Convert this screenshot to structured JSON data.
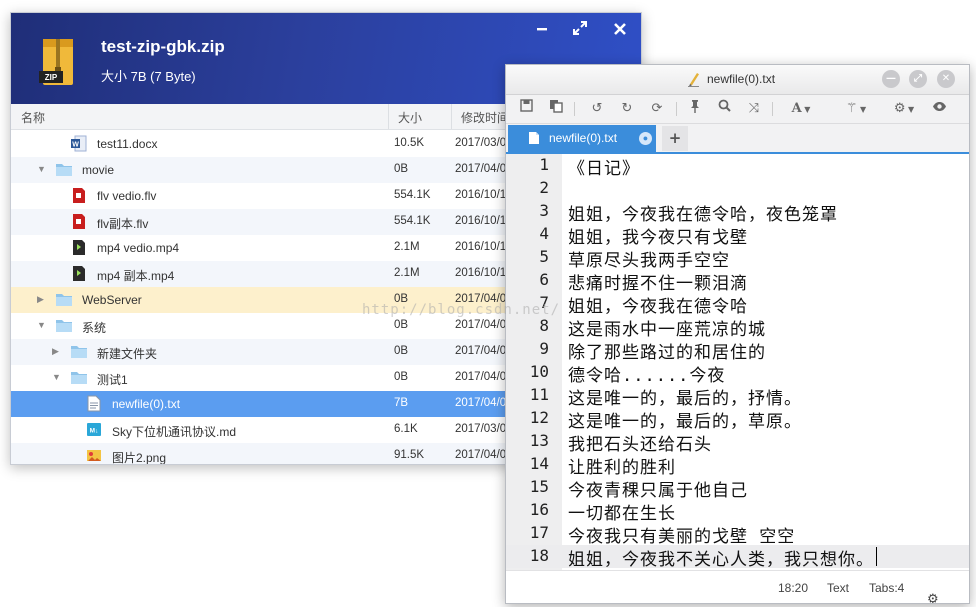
{
  "zip": {
    "title": "test-zip-gbk.zip",
    "subtitle": "大小 7B (7 Byte)",
    "icon_label": "ZIP",
    "columns": {
      "name": "名称",
      "size": "大小",
      "date": "修改时间"
    },
    "rows": [
      {
        "name": "test11.docx",
        "size": "10.5K",
        "date": "2017/03/0",
        "icon": "word-doc-icon",
        "indent": 1,
        "expander": "none",
        "style": "plain"
      },
      {
        "name": "movie",
        "size": "0B",
        "date": "2017/04/0",
        "icon": "folder-icon",
        "indent": 0,
        "expander": "open",
        "style": "alt"
      },
      {
        "name": "flv vedio.flv",
        "size": "554.1K",
        "date": "2016/10/1",
        "icon": "flv-file-icon",
        "indent": 1,
        "expander": "none",
        "style": "plain"
      },
      {
        "name": "flv副本.flv",
        "size": "554.1K",
        "date": "2016/10/1",
        "icon": "flv-file-icon",
        "indent": 1,
        "expander": "none",
        "style": "alt"
      },
      {
        "name": "mp4 vedio.mp4",
        "size": "2.1M",
        "date": "2016/10/1",
        "icon": "mp4-file-icon",
        "indent": 1,
        "expander": "none",
        "style": "plain"
      },
      {
        "name": "mp4 副本.mp4",
        "size": "2.1M",
        "date": "2016/10/1",
        "icon": "mp4-file-icon",
        "indent": 1,
        "expander": "none",
        "style": "alt"
      },
      {
        "name": "WebServer",
        "size": "0B",
        "date": "2017/04/0",
        "icon": "folder-icon",
        "indent": 0,
        "expander": "closed",
        "style": "hl"
      },
      {
        "name": "系统",
        "size": "0B",
        "date": "2017/04/0",
        "icon": "folder-icon",
        "indent": 0,
        "expander": "open",
        "style": "plain"
      },
      {
        "name": "新建文件夹",
        "size": "0B",
        "date": "2017/04/0",
        "icon": "folder-icon",
        "indent": 1,
        "expander": "closed",
        "style": "alt"
      },
      {
        "name": "测试1",
        "size": "0B",
        "date": "2017/04/0",
        "icon": "folder-icon",
        "indent": 1,
        "expander": "open",
        "style": "plain"
      },
      {
        "name": "newfile(0).txt",
        "size": "7B",
        "date": "2017/04/0",
        "icon": "text-file-icon",
        "indent": 2,
        "expander": "none",
        "style": "sel"
      },
      {
        "name": "Sky下位机通讯协议.md",
        "size": "6.1K",
        "date": "2017/03/0",
        "icon": "markdown-file-icon",
        "indent": 2,
        "expander": "none",
        "style": "plain"
      },
      {
        "name": "图片2.png",
        "size": "91.5K",
        "date": "2017/04/0",
        "icon": "image-file-icon",
        "indent": 2,
        "expander": "none",
        "style": "alt"
      }
    ]
  },
  "editor": {
    "window_title": "newfile(0).txt",
    "tab_label": "newfile(0).txt",
    "tab_add": "+",
    "lines": [
      "《日记》",
      "",
      "姐姐，今夜我在德令哈，夜色笼罩",
      "姐姐，我今夜只有戈壁",
      "草原尽头我两手空空",
      "悲痛时握不住一颗泪滴",
      "姐姐，今夜我在德令哈",
      "这是雨水中一座荒凉的城",
      "除了那些路过的和居住的",
      "德令哈......今夜",
      "这是唯一的，最后的，抒情。",
      "这是唯一的，最后的，草原。",
      "我把石头还给石头",
      "让胜利的胜利",
      "今夜青稞只属于他自己",
      "一切都在生长",
      "今夜我只有美丽的戈壁 空空",
      "姐姐，今夜我不关心人类，我只想你。"
    ],
    "current_line": 18,
    "status": {
      "position": "18:20",
      "mode": "Text",
      "tabs": "Tabs:4"
    }
  },
  "watermark": "http://blog.csdn.net/",
  "colors": {
    "header_blue": "#2b3f9c",
    "accent_blue": "#3b8ddb",
    "selected_row": "#5b9df0",
    "highlight_row": "#fdf0cc"
  }
}
